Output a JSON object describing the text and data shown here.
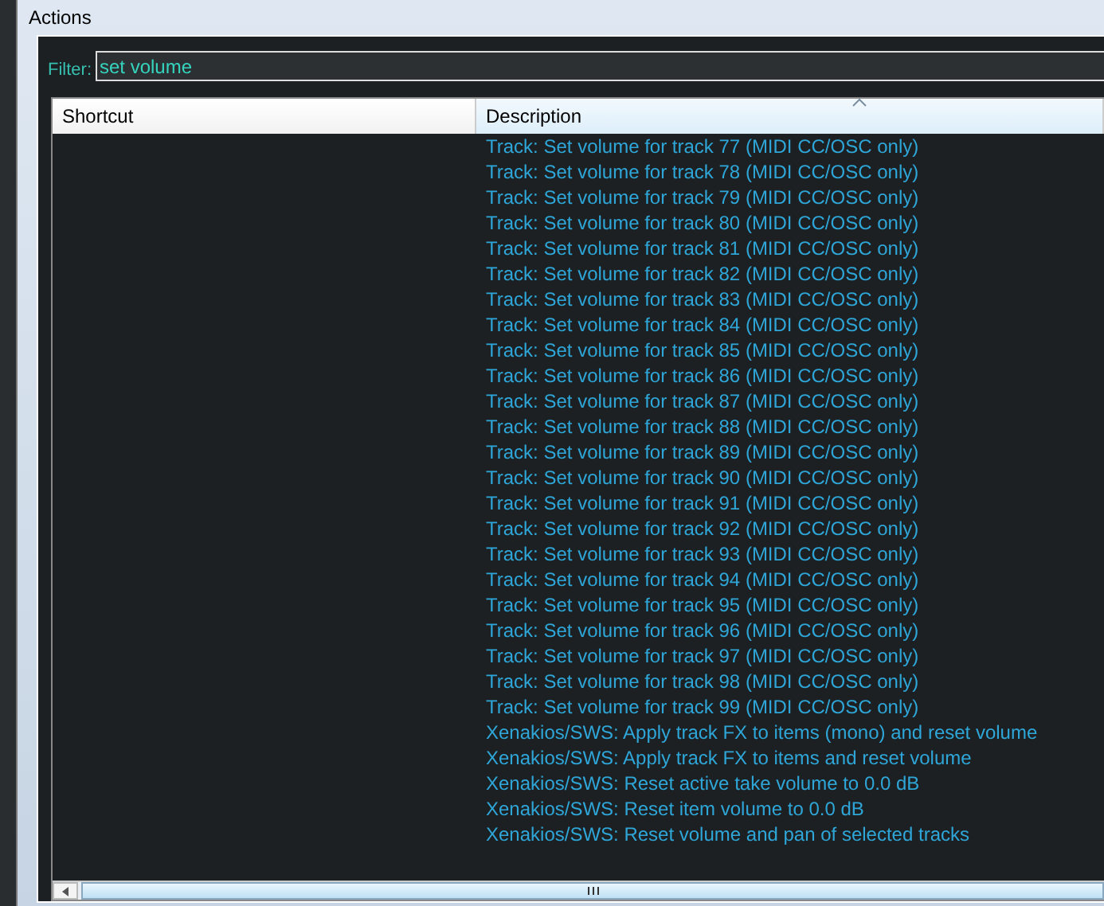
{
  "window": {
    "title": "Actions"
  },
  "filter": {
    "label": "Filter:",
    "value": "set volume"
  },
  "table": {
    "columns": [
      {
        "label": "Shortcut",
        "sorted": false
      },
      {
        "label": "Description",
        "sorted": true
      }
    ],
    "rows": [
      {
        "description": "Track: Set volume for track 77 (MIDI CC/OSC only)"
      },
      {
        "description": "Track: Set volume for track 78 (MIDI CC/OSC only)"
      },
      {
        "description": "Track: Set volume for track 79 (MIDI CC/OSC only)"
      },
      {
        "description": "Track: Set volume for track 80 (MIDI CC/OSC only)"
      },
      {
        "description": "Track: Set volume for track 81 (MIDI CC/OSC only)"
      },
      {
        "description": "Track: Set volume for track 82 (MIDI CC/OSC only)"
      },
      {
        "description": "Track: Set volume for track 83 (MIDI CC/OSC only)"
      },
      {
        "description": "Track: Set volume for track 84 (MIDI CC/OSC only)"
      },
      {
        "description": "Track: Set volume for track 85 (MIDI CC/OSC only)"
      },
      {
        "description": "Track: Set volume for track 86 (MIDI CC/OSC only)"
      },
      {
        "description": "Track: Set volume for track 87 (MIDI CC/OSC only)"
      },
      {
        "description": "Track: Set volume for track 88 (MIDI CC/OSC only)"
      },
      {
        "description": "Track: Set volume for track 89 (MIDI CC/OSC only)"
      },
      {
        "description": "Track: Set volume for track 90 (MIDI CC/OSC only)"
      },
      {
        "description": "Track: Set volume for track 91 (MIDI CC/OSC only)"
      },
      {
        "description": "Track: Set volume for track 92 (MIDI CC/OSC only)"
      },
      {
        "description": "Track: Set volume for track 93 (MIDI CC/OSC only)"
      },
      {
        "description": "Track: Set volume for track 94 (MIDI CC/OSC only)"
      },
      {
        "description": "Track: Set volume for track 95 (MIDI CC/OSC only)"
      },
      {
        "description": "Track: Set volume for track 96 (MIDI CC/OSC only)"
      },
      {
        "description": "Track: Set volume for track 97 (MIDI CC/OSC only)"
      },
      {
        "description": "Track: Set volume for track 98 (MIDI CC/OSC only)"
      },
      {
        "description": "Track: Set volume for track 99 (MIDI CC/OSC only)"
      },
      {
        "description": "Xenakios/SWS: Apply track FX to items (mono) and reset volume"
      },
      {
        "description": "Xenakios/SWS: Apply track FX to items and reset volume"
      },
      {
        "description": "Xenakios/SWS: Reset active take volume to 0.0 dB"
      },
      {
        "description": "Xenakios/SWS: Reset item volume to 0.0 dB"
      },
      {
        "description": "Xenakios/SWS: Reset volume and pan of selected tracks"
      }
    ]
  }
}
